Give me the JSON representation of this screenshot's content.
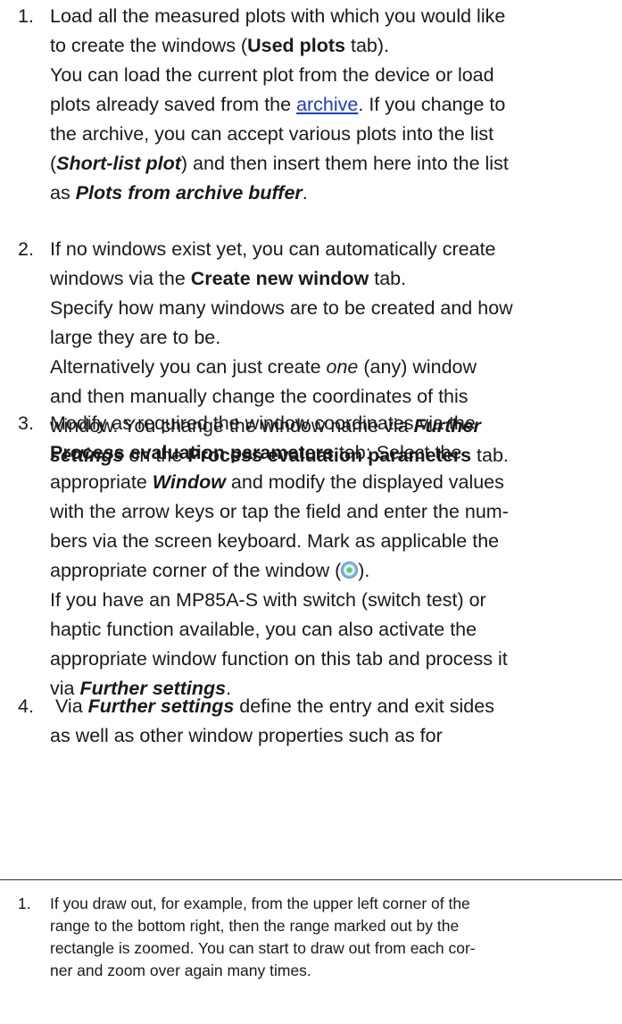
{
  "steps": [
    {
      "number": "1.",
      "lines": [
        [
          "Load all the measured plots with which you would like"
        ],
        [
          "to create the windows (",
          {
            "b": "Used plots"
          },
          " tab)."
        ],
        [
          "You can load the current plot from the device or load"
        ],
        [
          "plots already saved from the ",
          {
            "link": "archive"
          },
          ". If you change to"
        ],
        [
          "the archive, you can accept various plots into the list"
        ],
        [
          "(",
          {
            "bi": "Short-list plot"
          },
          ") and then insert them here into the list"
        ],
        [
          "as ",
          {
            "bi": "Plots from archive buffer"
          },
          "."
        ]
      ]
    },
    {
      "number": "2.",
      "lines": [
        [
          "If no windows exist yet, you can automatically create"
        ],
        [
          "windows via the ",
          {
            "b": "Create new window"
          },
          " tab."
        ],
        [
          "Specify how many windows are to be created and how"
        ],
        [
          "large they are to be."
        ],
        [
          "Alternatively you can just create ",
          {
            "i": "one"
          },
          " (any) window"
        ],
        [
          "and then manually change the coordinates of this"
        ],
        [
          "window. You change the window name via ",
          {
            "bi": "Further"
          }
        ],
        [
          {
            "bi": "settings"
          },
          " on the ",
          {
            "b": "Process evaluation parameters"
          },
          " tab."
        ]
      ]
    },
    {
      "number": "3.",
      "lines": [
        [
          "Modify as required the window coordinates via the"
        ],
        [
          {
            "b": "Process evaluation parameters"
          },
          " tab: Select the"
        ],
        [
          "appropriate ",
          {
            "bi": "Window"
          },
          " and modify the displayed values"
        ],
        [
          "with the arrow keys or tap the field and enter the num-"
        ],
        [
          "bers via the screen keyboard. Mark as applicable the"
        ],
        [
          "appropriate corner of the window (",
          {
            "icon": "radio-icon"
          },
          ")."
        ],
        [
          "If you have an MP85A-S with switch (switch test) or"
        ],
        [
          "haptic function available, you can also activate the"
        ],
        [
          "appropriate window function on this tab and process it"
        ],
        [
          "via ",
          {
            "bi": "Further settings"
          },
          "."
        ]
      ]
    },
    {
      "number": "4.",
      "lines": [
        [
          " Via ",
          {
            "bi": "Further settings"
          },
          " define the entry and exit sides"
        ],
        [
          "as well as other window properties such as for"
        ]
      ]
    }
  ],
  "footnote": {
    "number": "1.",
    "lines": [
      "If you draw out, for example, from the upper left corner of the",
      "range to the bottom right, then the range marked out by the",
      "rectangle is zoomed. You can start to draw out from each cor-",
      "ner and zoom over again many times."
    ]
  }
}
